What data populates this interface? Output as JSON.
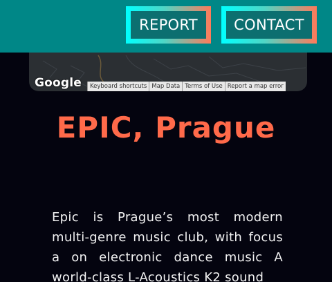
{
  "nav": {
    "report_label": "REPORT",
    "contact_label": "CONTACT"
  },
  "map": {
    "logo_text": "Google",
    "footer_links": [
      "Keyboard shortcuts",
      "Map Data",
      "Terms of Use",
      "Report a map error"
    ]
  },
  "venue": {
    "title": "EPIC, Prague",
    "description": "Epic is Prague’s most modern multi-genre music club, with focus a on electronic dance music A world-class L-Acoustics K2 sound"
  },
  "colors": {
    "header_bg": "#008787",
    "page_bg": "#04040f",
    "title_accent": "#ff6a4a",
    "button_border_start": "#00ffff",
    "button_border_end": "#ff7a5a"
  }
}
